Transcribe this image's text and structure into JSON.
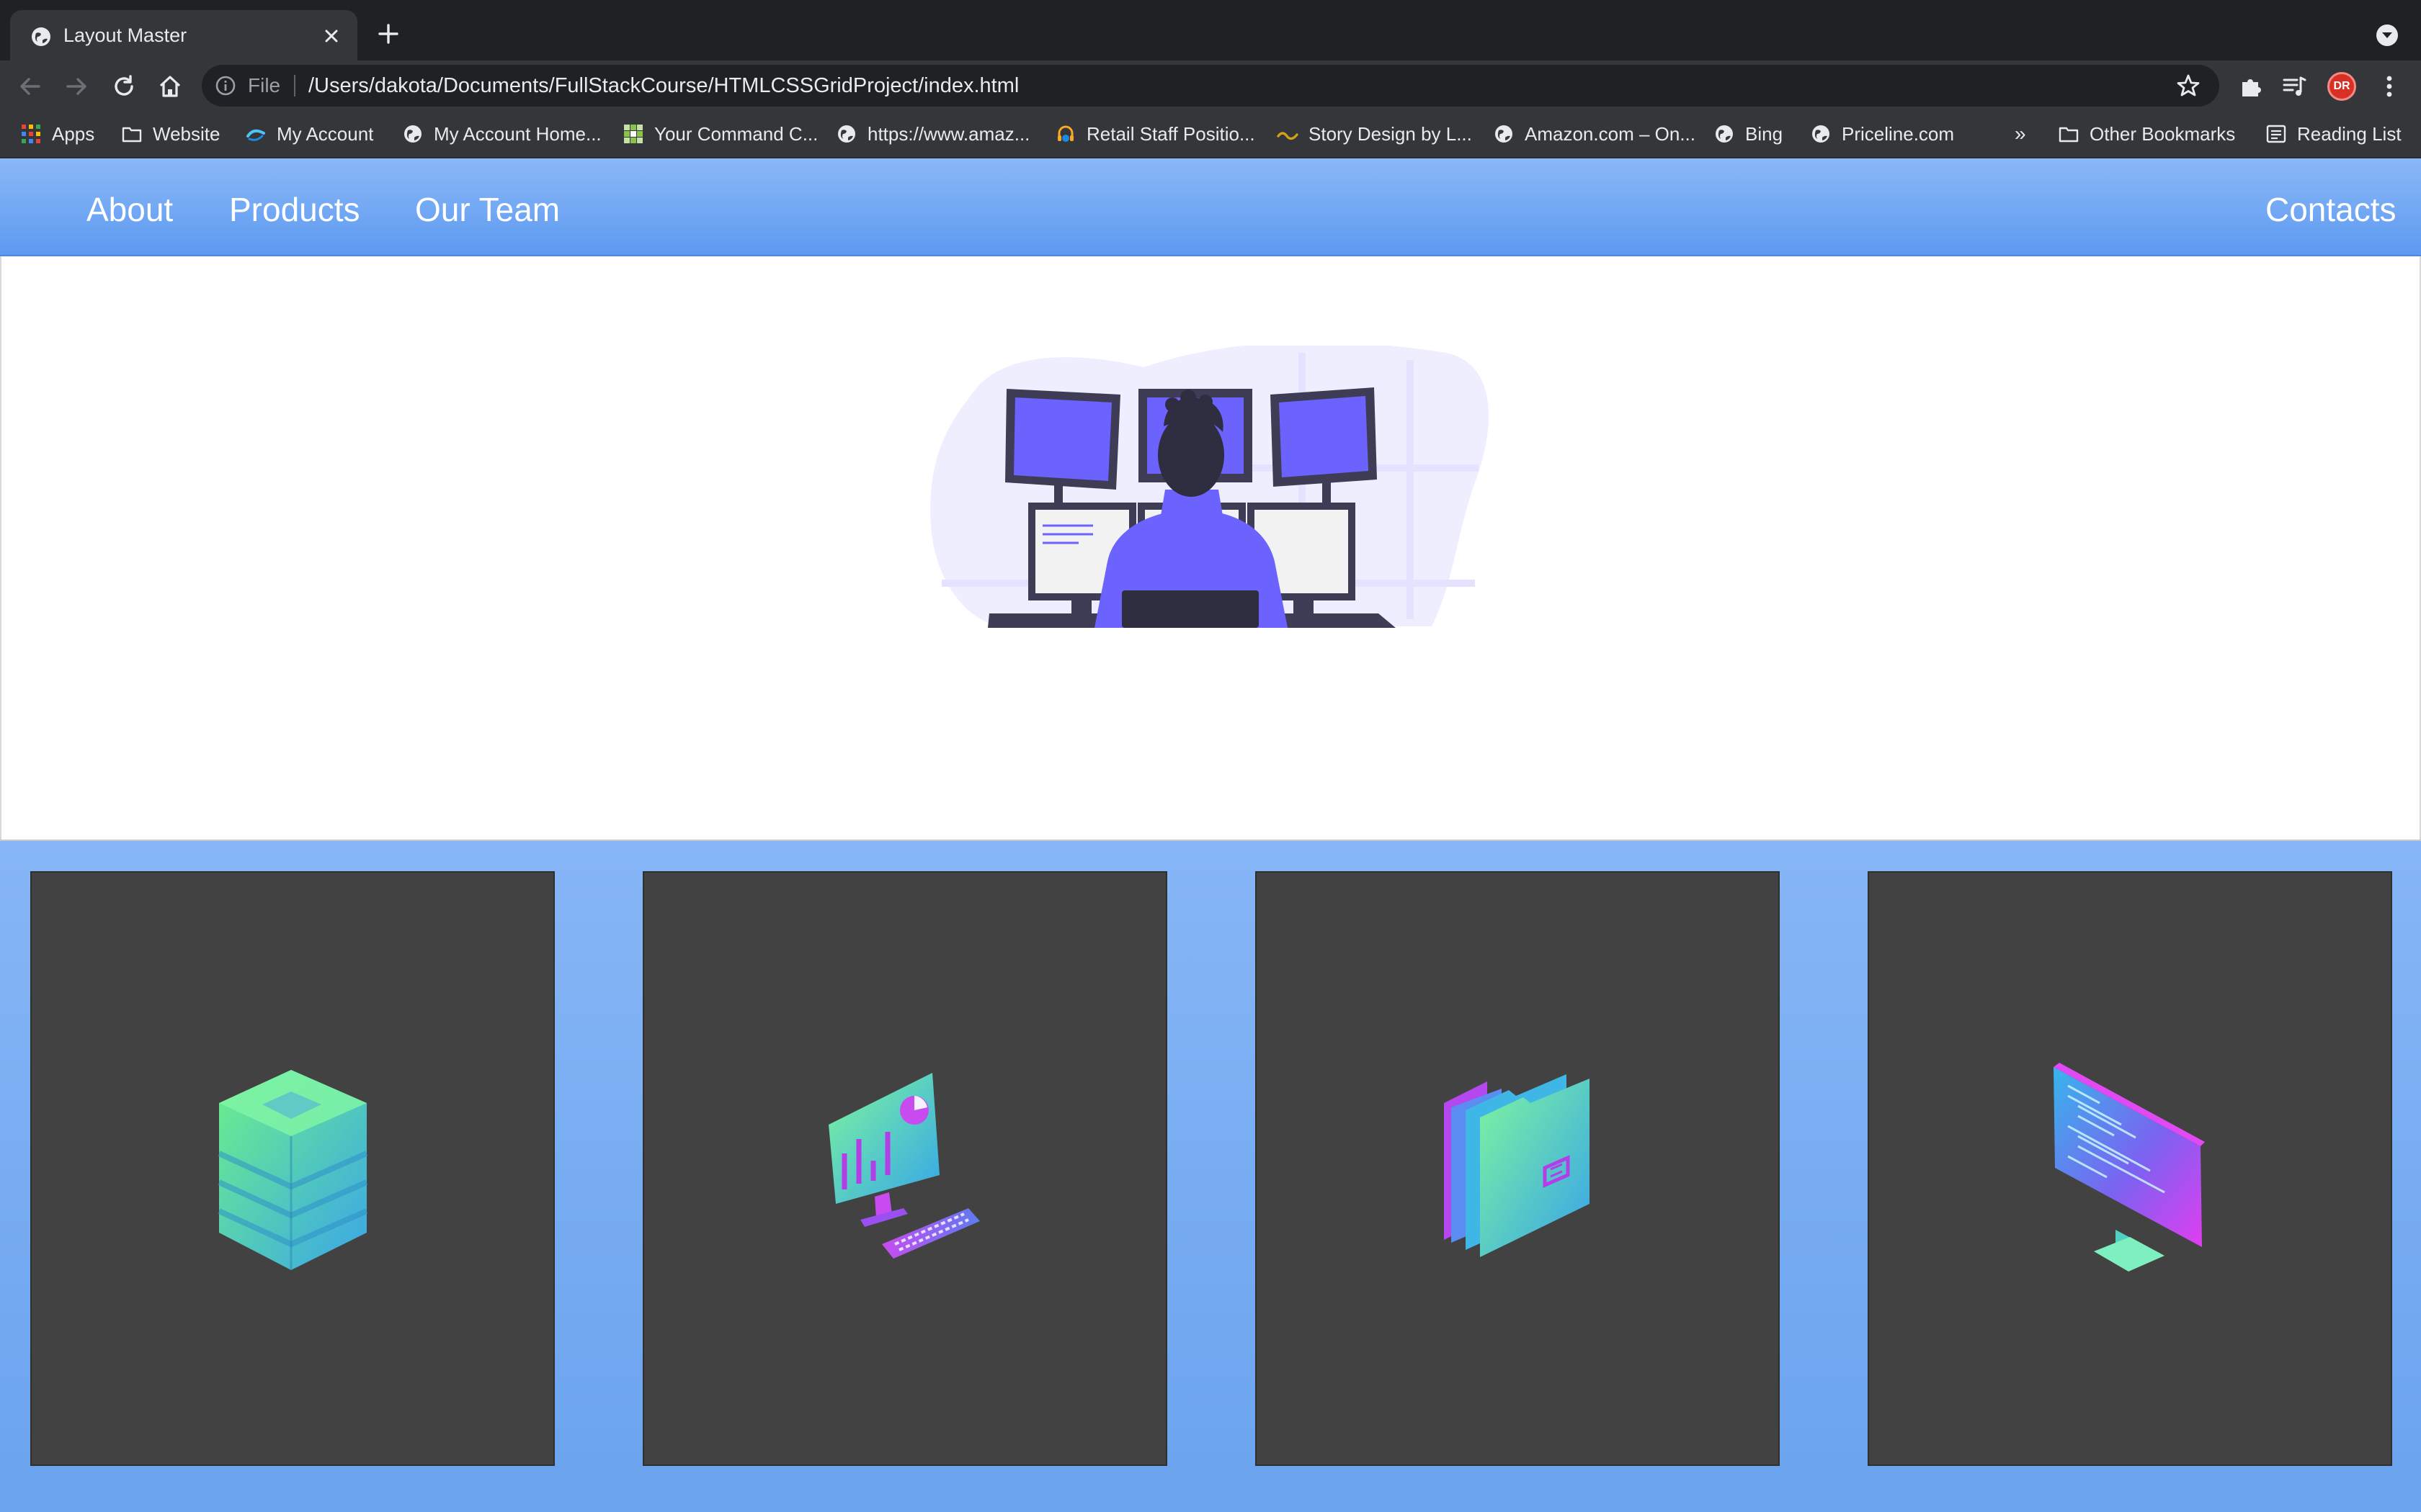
{
  "browser": {
    "tab": {
      "title": "Layout Master"
    },
    "address_bar": {
      "scheme_label": "File",
      "url": "/Users/dakota/Documents/FullStackCourse/HTMLCSSGridProject/index.html"
    },
    "profile_initials": "DR",
    "bookmarks": [
      {
        "label": "Apps",
        "icon": "apps-grid-icon"
      },
      {
        "label": "Website",
        "icon": "folder-icon"
      },
      {
        "label": "My Account",
        "icon": "account-swirl-icon"
      },
      {
        "label": "My Account Home...",
        "icon": "globe-icon"
      },
      {
        "label": "Your Command C...",
        "icon": "checker-icon"
      },
      {
        "label": "https://www.amaz...",
        "icon": "globe-icon"
      },
      {
        "label": "Retail Staff Positio...",
        "icon": "headset-icon"
      },
      {
        "label": "Story Design by L...",
        "icon": "story-icon"
      },
      {
        "label": "Amazon.com – On...",
        "icon": "globe-icon"
      },
      {
        "label": "Bing",
        "icon": "globe-icon"
      },
      {
        "label": "Priceline.com",
        "icon": "globe-icon"
      }
    ],
    "bookmarks_overflow": "»",
    "other_bookmarks": "Other Bookmarks",
    "reading_list": "Reading List"
  },
  "page": {
    "nav": {
      "links": [
        "About",
        "Products",
        "Our Team"
      ],
      "contacts": "Contacts"
    },
    "hero": {
      "illustration": "developer-at-multiple-monitors-illustration"
    },
    "cards": [
      {
        "icon": "database-stack-icon"
      },
      {
        "icon": "analytics-monitor-keyboard-icon"
      },
      {
        "icon": "file-folders-icon"
      },
      {
        "icon": "code-monitor-icon"
      }
    ]
  },
  "colors": {
    "nav_gradient_top": "#8ab8f8",
    "nav_gradient_bottom": "#5e9af0",
    "card_bg": "#424242",
    "illustration_purple": "#6c63ff"
  }
}
